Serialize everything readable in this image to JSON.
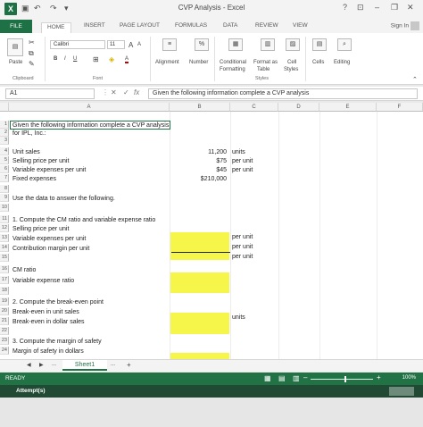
{
  "window": {
    "title": "CVP Analysis - Excel",
    "app_icon": "X",
    "help": "?",
    "ribbon_display": "⊡",
    "minimize": "–",
    "restore": "❐",
    "close": "✕"
  },
  "tabs": [
    "FILE",
    "HOME",
    "INSERT",
    "PAGE LAYOUT",
    "FORMULAS",
    "DATA",
    "REVIEW",
    "VIEW"
  ],
  "sign_in": "Sign In",
  "ribbon": {
    "paste": "Paste",
    "clipboard": "Clipboard",
    "font_name": "Calibri",
    "font_size": "11",
    "font_group": "Font",
    "bold": "B",
    "italic": "I",
    "underline": "U",
    "grow_font": "A",
    "shrink_font": "A",
    "font_color": "A",
    "alignment": "Alignment",
    "number": "Number",
    "percent": "%",
    "conditional_formatting_1": "Conditional",
    "conditional_formatting_2": "Formatting",
    "format_as_table_1": "Format as",
    "format_as_table_2": "Table",
    "cell_styles_1": "Cell",
    "cell_styles_2": "Styles",
    "styles_group": "Styles",
    "cells": "Cells",
    "editing": "Editing"
  },
  "formula_bar": {
    "name_box": "A1",
    "fx": "fx",
    "cancel": "✕",
    "enter": "✓",
    "content": "Given the following information complete a CVP analysis"
  },
  "columns": [
    "A",
    "B",
    "C",
    "D",
    "E",
    "F"
  ],
  "rows": [
    "1",
    "2",
    "3",
    "4",
    "5",
    "6",
    "7",
    "8",
    "9",
    "10",
    "11",
    "12",
    "13",
    "14",
    "15",
    "16",
    "17",
    "18",
    "19",
    "20",
    "21",
    "22",
    "23",
    "24"
  ],
  "cells": {
    "a1": "Given the following information complete a CVP analysis",
    "a2": "for IPL, Inc.:",
    "a4": "Unit sales",
    "b4": "11,200",
    "c4": "units",
    "a5": "Selling price per unit",
    "b5": "$75",
    "c5": "per unit",
    "a6": "Variable expenses per unit",
    "b6": "$45",
    "c6": "per unit",
    "a7": "Fixed expenses",
    "b7": "$210,000",
    "a9": "Use the data to answer the following.",
    "a11": "1. Compute the CM ratio and variable expense ratio",
    "a12": "Selling price per unit",
    "c12": "per unit",
    "a13": "Variable expenses per unit",
    "c13": "per unit",
    "a14": "Contribution margin per unit",
    "c14": "per unit",
    "a16": "CM ratio",
    "a17": "Variable expense ratio",
    "a19": "2. Compute the break-even point",
    "a20": "Break-even in unit sales",
    "c20": "units",
    "a21": "Break-even in dollar sales",
    "a23": "3. Compute the margin of safety",
    "a24": "Margin of safety in dollars"
  },
  "sheet_tab": "Sheet1",
  "sheet_nav": {
    "prev": "◀",
    "next": "▶",
    "more": "...",
    "add": "+"
  },
  "status": {
    "ready": "READY",
    "zoom": "100%"
  },
  "attempts": "Attempt(s)",
  "colors": {
    "excel_green": "#217346",
    "input_yellow": "#f5f54a"
  }
}
